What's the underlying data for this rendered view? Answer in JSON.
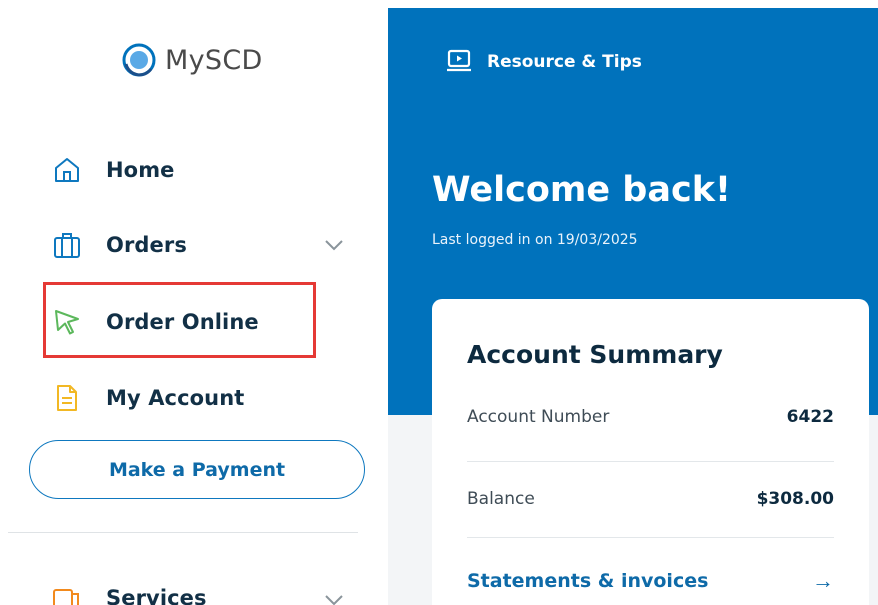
{
  "brand": {
    "name": "MySCD"
  },
  "sidebar": {
    "items": [
      {
        "label": "Home",
        "icon": "home-icon"
      },
      {
        "label": "Orders",
        "icon": "briefcase-icon",
        "expandable": true
      },
      {
        "label": "Order Online",
        "icon": "cursor-arrow-icon",
        "highlighted": true
      },
      {
        "label": "My Account",
        "icon": "document-icon"
      },
      {
        "label": "Services",
        "icon": "services-icon",
        "expandable": true
      }
    ],
    "pay_button": "Make a Payment"
  },
  "header": {
    "resources_label": "Resource & Tips"
  },
  "hero": {
    "title": "Welcome back!",
    "last_login": "Last logged in on 19/03/2025"
  },
  "summary": {
    "title": "Account Summary",
    "rows": [
      {
        "label": "Account Number",
        "value": "6422"
      },
      {
        "label": "Balance",
        "value": "$308.00"
      }
    ],
    "link": "Statements & invoices"
  },
  "colors": {
    "primary": "#0072bc",
    "highlight": "#e53935",
    "icon_green": "#5cb85c",
    "icon_yellow": "#f2b824",
    "icon_orange": "#f28a1d"
  }
}
